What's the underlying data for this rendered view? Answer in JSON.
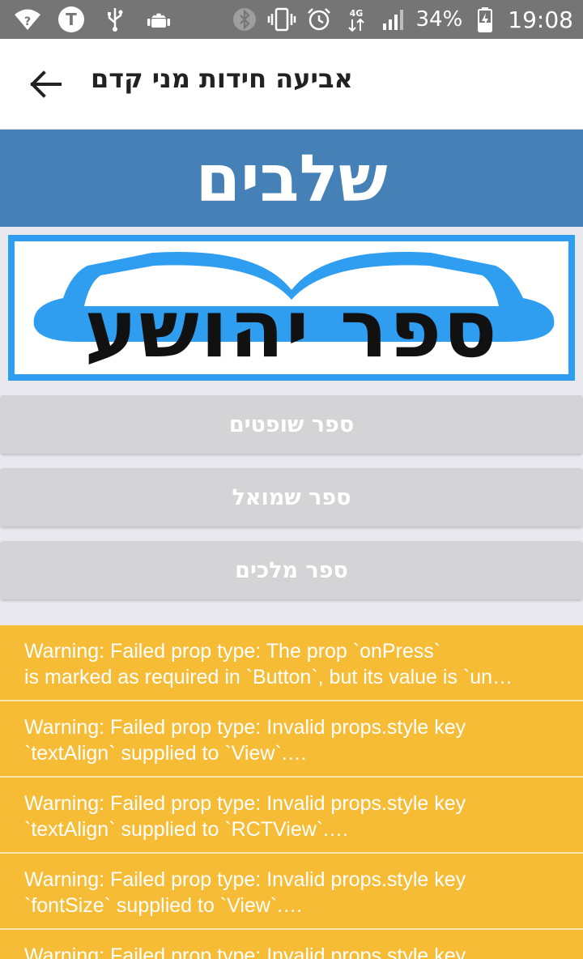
{
  "status_bar": {
    "left_icons": [
      "wifi-question-icon",
      "t-badge-icon",
      "usb-icon",
      "android-icon"
    ],
    "t_badge_letter": "T",
    "right_icons": [
      "bluetooth-icon",
      "vibrate-icon",
      "alarm-icon",
      "network-4g-icon",
      "signal-icon"
    ],
    "network_label": "4G",
    "battery_percent": "34%",
    "time": "19:08"
  },
  "toolbar": {
    "title": "אביעה חידות מני קדם"
  },
  "header": {
    "title": "שלבים"
  },
  "logo": {
    "text": "ספר יהושע"
  },
  "books": [
    {
      "label": "ספר שופטים"
    },
    {
      "label": "ספר שמואל"
    },
    {
      "label": "ספר מלכים"
    }
  ],
  "warnings": [
    {
      "line1": "Warning: Failed prop type: The prop `onPress`",
      "line2": "is marked as required in `Button`, but its value is `un…"
    },
    {
      "line1": "Warning: Failed prop type: Invalid props.style key",
      "line2": "`textAlign` supplied to `View`.…"
    },
    {
      "line1": "Warning: Failed prop type: Invalid props.style key",
      "line2": "`textAlign` supplied to `RCTView`.…"
    },
    {
      "line1": "Warning: Failed prop type: Invalid props.style key",
      "line2": "`fontSize` supplied to `View`.…"
    },
    {
      "line1": "Warning: Failed prop type: Invalid props.style key",
      "line2": ""
    }
  ],
  "colors": {
    "status_bar": "#757575",
    "header_blue": "#4581b6",
    "logo_border": "#2f9ef0",
    "book_button": "#d4d4d6",
    "warning": "#f6bc36"
  }
}
